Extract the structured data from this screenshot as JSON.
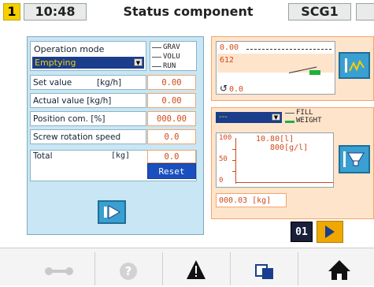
{
  "header": {
    "station_number": "1",
    "time": "10:48",
    "title": "Status component",
    "component_id": "SCG1"
  },
  "operation": {
    "label": "Operation mode",
    "selected": "Emptying",
    "modes": [
      "GRAV",
      "VOLU",
      "RUN"
    ]
  },
  "rows": [
    {
      "label": "Set value",
      "unit": "[kg/h]",
      "value": "0.00"
    },
    {
      "label": "Actual value [kg/h]",
      "unit": "",
      "value": "0.00"
    },
    {
      "label": "Position com. [%]",
      "unit": "",
      "value": "000.00"
    },
    {
      "label": "Screw rotation speed",
      "unit": "",
      "value": "0.0"
    }
  ],
  "total": {
    "label": "Total",
    "unit": "[kg]",
    "value": "0.0",
    "reset_label": "Reset"
  },
  "display1": {
    "line1": "0.00",
    "line2": "612",
    "rotation_value": "0.0"
  },
  "feed": {
    "dropdown_value": "---",
    "options": [
      "FILL",
      "WEIGHT"
    ],
    "y_max": "100",
    "y_mid": "50",
    "y_min": "0",
    "reading": "10.80[l]",
    "reading2": "800[g/l]",
    "weight": "000.03 [kg]"
  },
  "nav": {
    "page": "01"
  },
  "colors": {
    "panel_blue": "#c8e6f4",
    "panel_orange": "#ffe4cc",
    "value_orange": "#d04a1a",
    "select_blue": "#1a3d8c",
    "yellow": "#f4d000",
    "button_blue": "#3a9fd1"
  },
  "icons": {
    "wrench": "wrench-icon",
    "help": "help-icon",
    "alarm": "warning-icon",
    "screens": "screens-icon",
    "home": "home-icon"
  }
}
